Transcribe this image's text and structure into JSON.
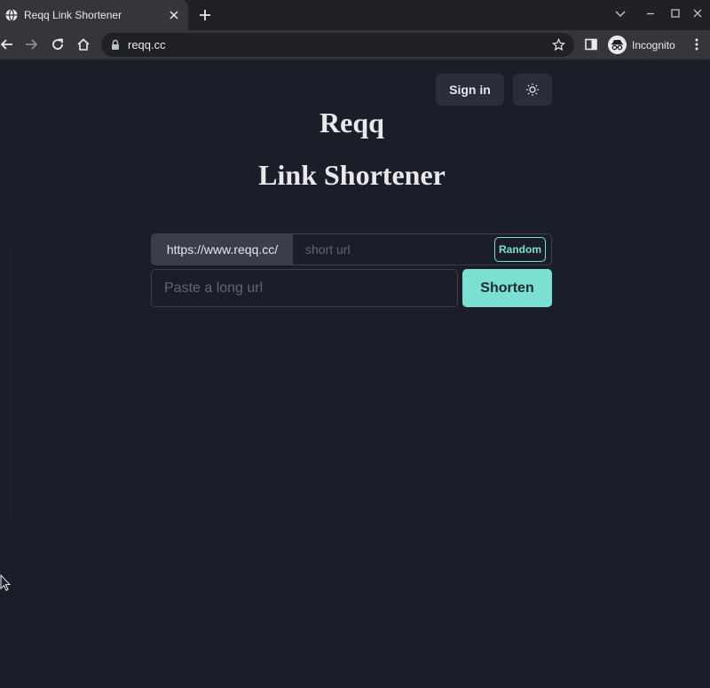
{
  "browser": {
    "tab_title": "Reqq Link Shortener",
    "url": "reqq.cc",
    "incognito_label": "Incognito"
  },
  "header": {
    "signin_label": "Sign in"
  },
  "hero": {
    "brand": "Reqq",
    "subtitle": "Link Shortener"
  },
  "form": {
    "domain_prefix": "https://www.reqq.cc/",
    "short_placeholder": "short url",
    "random_label": "Random",
    "long_placeholder": "Paste a long url",
    "shorten_label": "Shorten"
  },
  "colors": {
    "page_background": "#1b1e28",
    "accent": "#7be0d1",
    "button_background": "#2a2e3b"
  },
  "icons": [
    "globe-icon",
    "close-icon",
    "plus-icon",
    "back-icon",
    "forward-icon",
    "reload-icon",
    "home-icon",
    "lock-icon",
    "star-icon",
    "side-panel-icon",
    "incognito-icon",
    "more-icon",
    "sun-icon",
    "cursor-icon"
  ]
}
